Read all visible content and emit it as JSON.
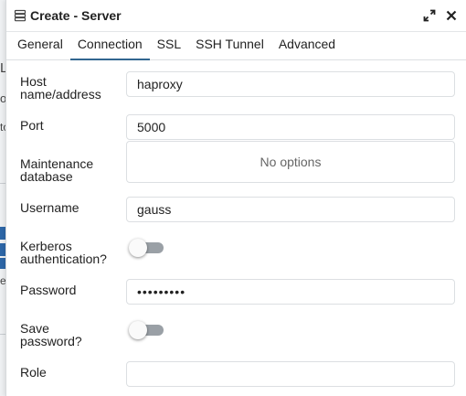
{
  "dialog": {
    "title": "Create - Server",
    "icon": "server-icon"
  },
  "tabs": [
    {
      "label": "General",
      "active": false
    },
    {
      "label": "Connection",
      "active": true
    },
    {
      "label": "SSL",
      "active": false
    },
    {
      "label": "SSH Tunnel",
      "active": false
    },
    {
      "label": "Advanced",
      "active": false
    }
  ],
  "form": {
    "host_label": "Host name/address",
    "host_value": "haproxy",
    "port_label": "Port",
    "port_value": "5000",
    "maintenance_label": "Maintenance database",
    "maintenance_placeholder": "No options",
    "username_label": "Username",
    "username_value": "gauss",
    "kerberos_label": "Kerberos authentication?",
    "kerberos_enabled": false,
    "password_label": "Password",
    "password_value": "•••••••••",
    "save_password_label": "Save password?",
    "save_password_enabled": false,
    "role_label": "Role",
    "role_value": ""
  },
  "background": {
    "marks": [
      "L",
      "o",
      "to",
      "e"
    ]
  },
  "colors": {
    "active_tab_underline": "#326690",
    "toggle_track": "#9aa0a6",
    "background_accent": "#2d66a7"
  }
}
